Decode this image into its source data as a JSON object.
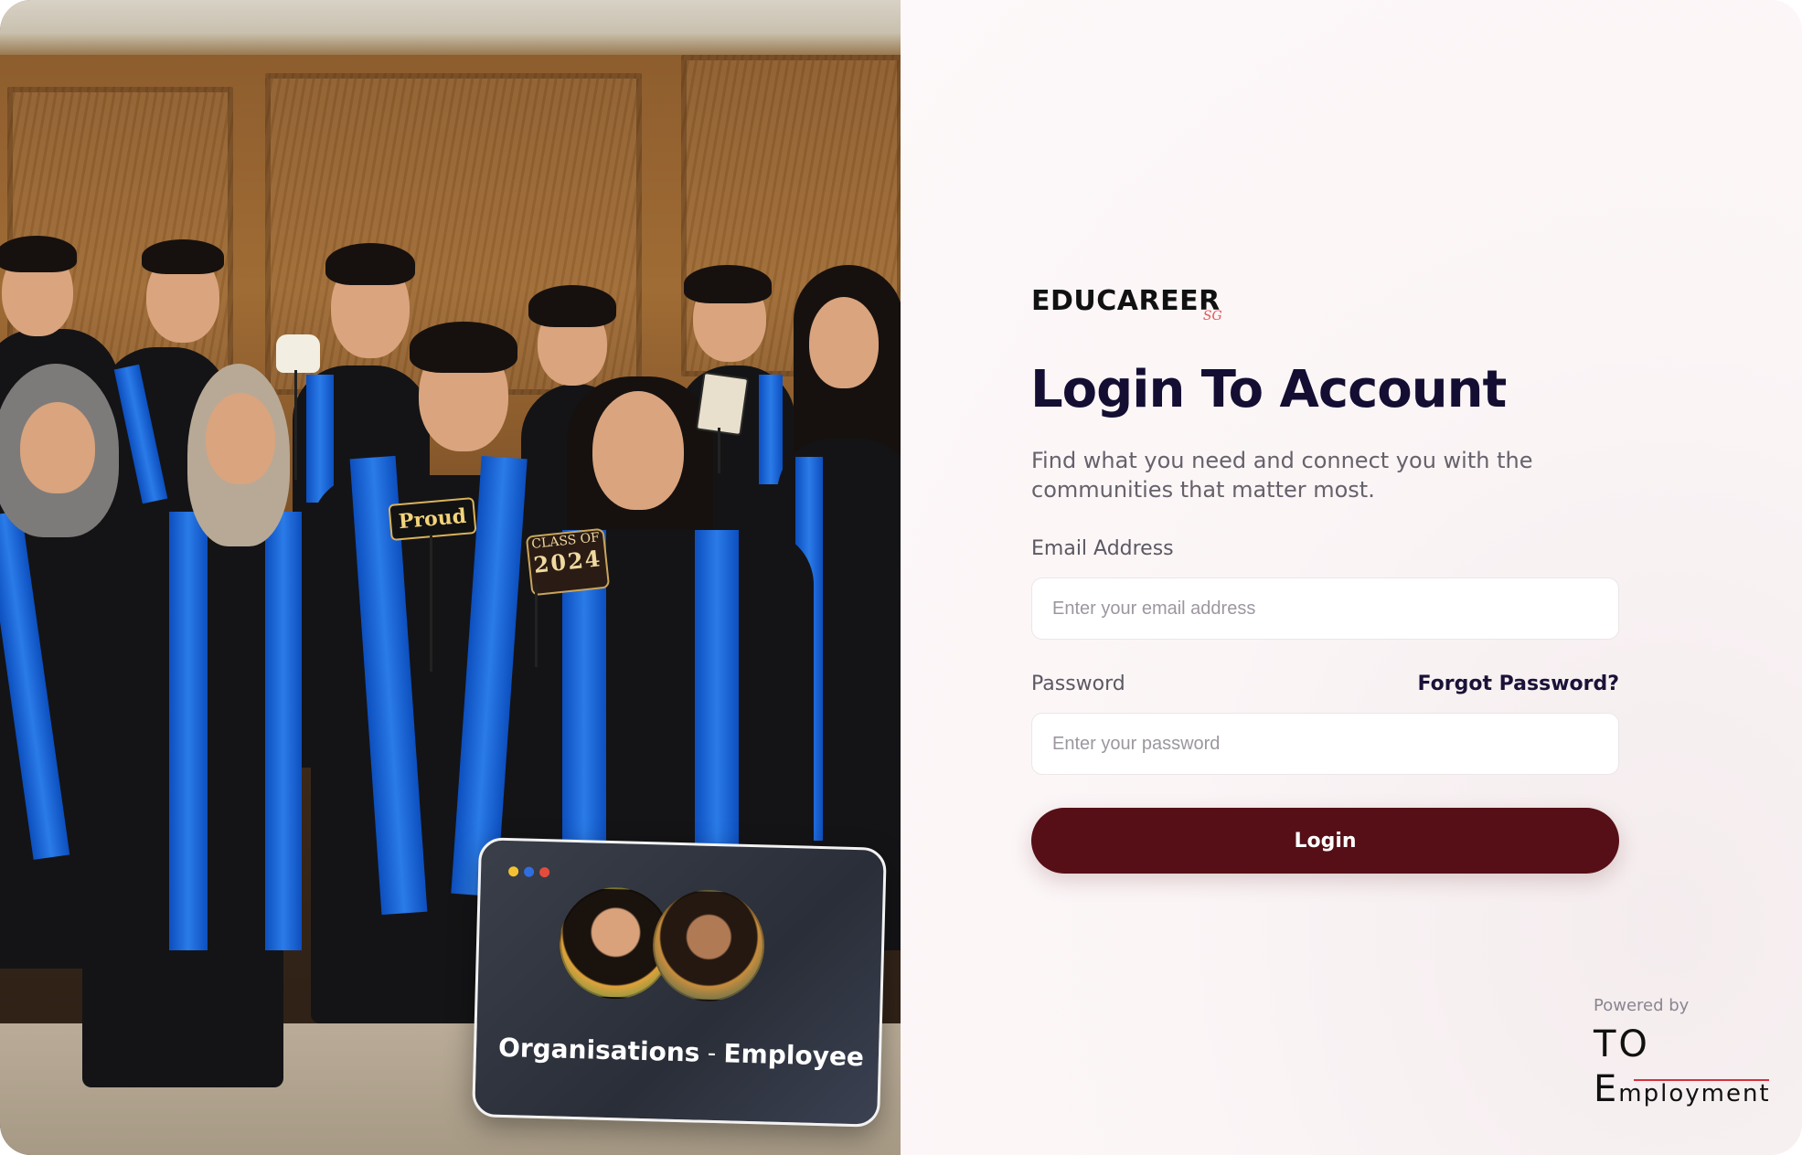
{
  "hero": {
    "prop_proud": "Proud",
    "prop_class_top": "CLASS OF",
    "prop_class_year": "2024",
    "card": {
      "dot_colors": [
        "#f2c230",
        "#2f6ee0",
        "#e34c3c"
      ],
      "left_label": "Organisations",
      "separator": "-",
      "right_label": "Employee"
    }
  },
  "login": {
    "logo": "EDUCAREER",
    "logo_sub": "SG",
    "title": "Login To Account",
    "subtitle": "Find what you need and connect you with the communities that matter most.",
    "email_label": "Email Address",
    "email_placeholder": "Enter your email address",
    "email_value": "",
    "password_label": "Password",
    "forgot_link": "Forgot Password?",
    "password_placeholder": "Enter your password",
    "password_value": "",
    "login_button": "Login"
  },
  "footer": {
    "powered_by": "Powered by",
    "brand_line1": "TO",
    "brand_line2_first": "E",
    "brand_line2_rest": "mployment"
  },
  "colors": {
    "primary_button": "#560f16",
    "title_text": "#150e33",
    "brand_rule": "#d8303a"
  }
}
